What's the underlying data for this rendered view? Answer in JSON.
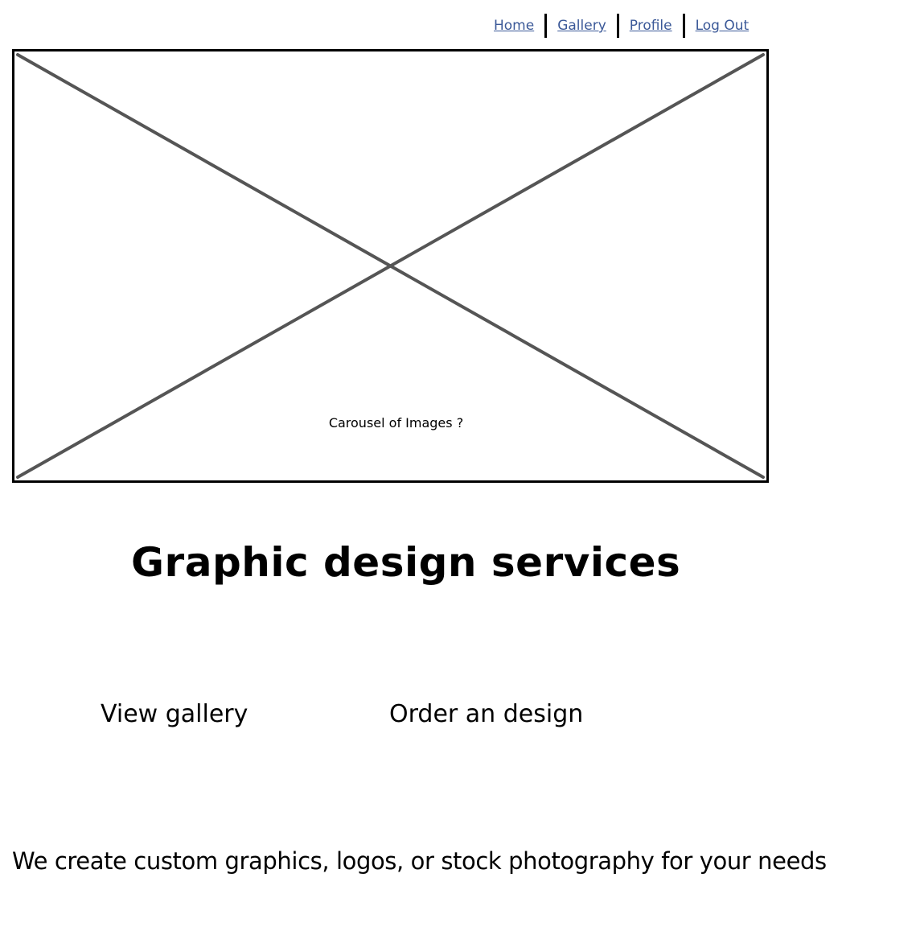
{
  "nav": {
    "items": [
      {
        "label": "Home"
      },
      {
        "label": "Gallery"
      },
      {
        "label": "Profile"
      },
      {
        "label": "Log Out"
      }
    ],
    "link_color": "#3b5998"
  },
  "carousel": {
    "caption": "Carousel of Images ?"
  },
  "hero": {
    "title": "Graphic design services"
  },
  "actions": {
    "view_gallery": "View gallery",
    "order_design": "Order an design"
  },
  "tagline": "We create custom graphics, logos, or stock photography for your needs"
}
